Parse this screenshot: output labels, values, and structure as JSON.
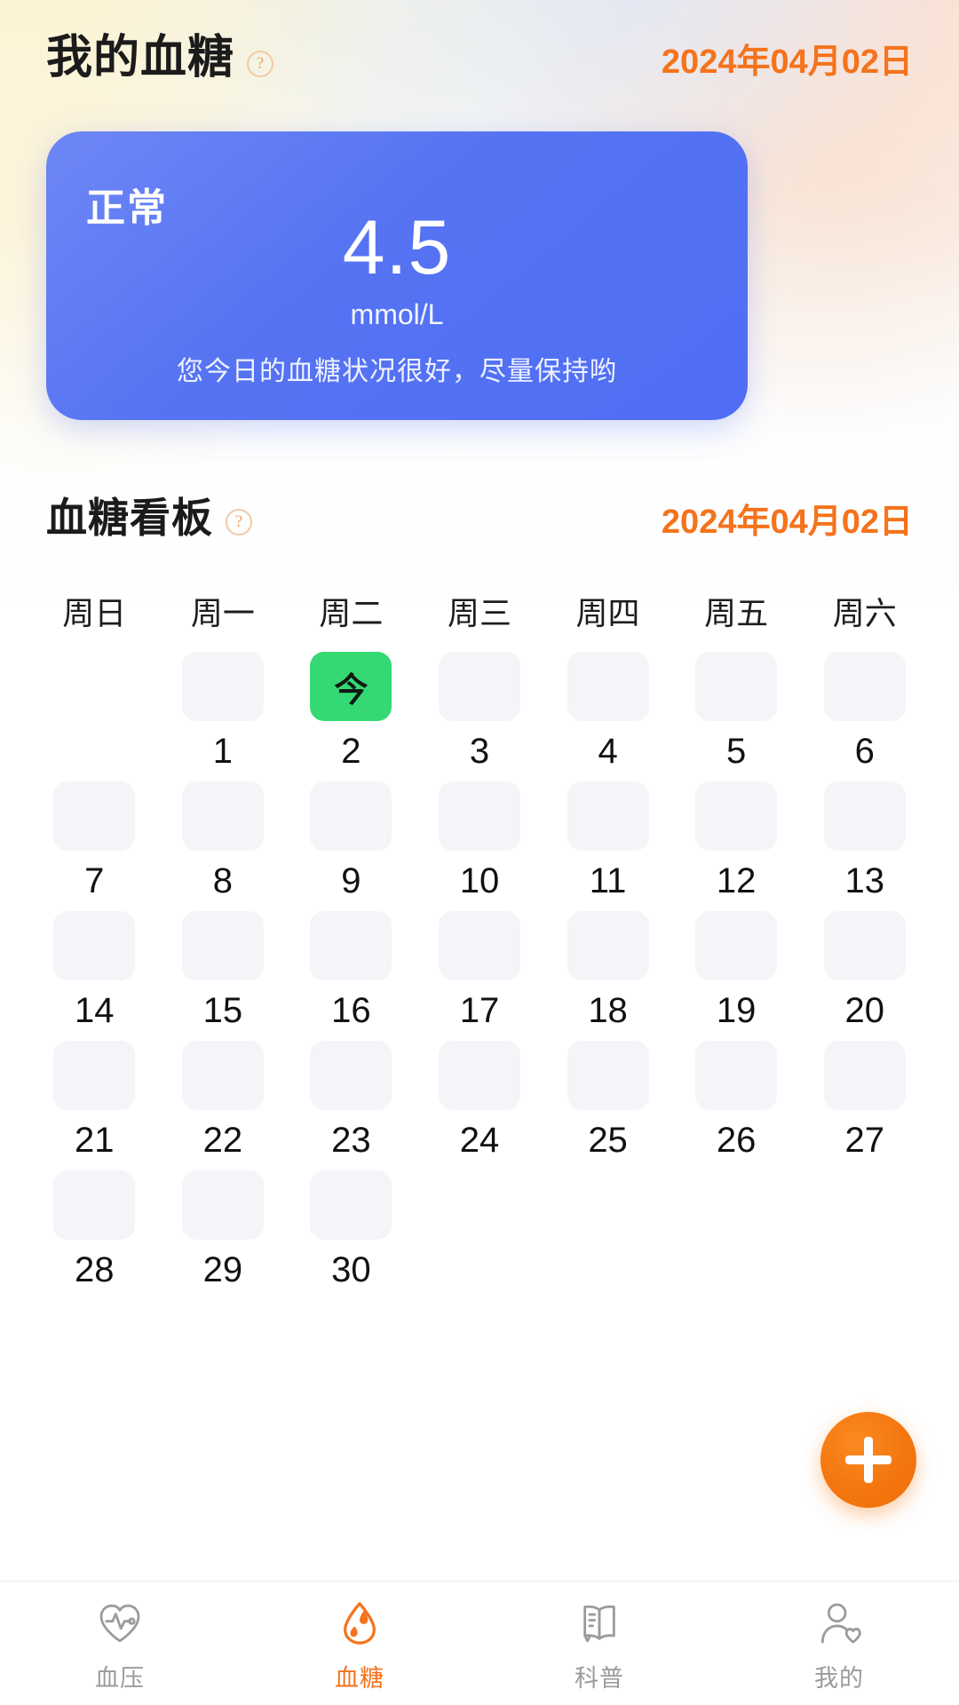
{
  "header": {
    "title": "我的血糖",
    "help_icon": "question-mark-circle-icon",
    "date": "2024年04月02日"
  },
  "status_card": {
    "level_label": "正常",
    "value": "4.5",
    "unit": "mmol/L",
    "tip": "您今日的血糖状况很好，尽量保持哟",
    "card_color": "#5573f2"
  },
  "board": {
    "title": "血糖看板",
    "help_icon": "question-mark-circle-icon",
    "date": "2024年04月02日",
    "weekdays": [
      "周日",
      "周一",
      "周二",
      "周三",
      "周四",
      "周五",
      "周六"
    ],
    "today_label": "今",
    "today_color": "#35d973",
    "leading_blanks": 1,
    "days": [
      "1",
      "2",
      "3",
      "4",
      "5",
      "6",
      "7",
      "8",
      "9",
      "10",
      "11",
      "12",
      "13",
      "14",
      "15",
      "16",
      "17",
      "18",
      "19",
      "20",
      "21",
      "22",
      "23",
      "24",
      "25",
      "26",
      "27",
      "28",
      "29",
      "30"
    ],
    "today_index": 1
  },
  "fab": {
    "icon": "plus-icon",
    "label": "+",
    "color": "#f4760f"
  },
  "bottom_nav": {
    "items": [
      {
        "label": "血压",
        "icon": "heart-pulse-icon",
        "active": false
      },
      {
        "label": "血糖",
        "icon": "blood-drop-icon",
        "active": true
      },
      {
        "label": "科普",
        "icon": "book-icon",
        "active": false
      },
      {
        "label": "我的",
        "icon": "person-heart-icon",
        "active": false
      }
    ],
    "active_color": "#f4731c",
    "inactive_color": "#9b9b9b"
  }
}
